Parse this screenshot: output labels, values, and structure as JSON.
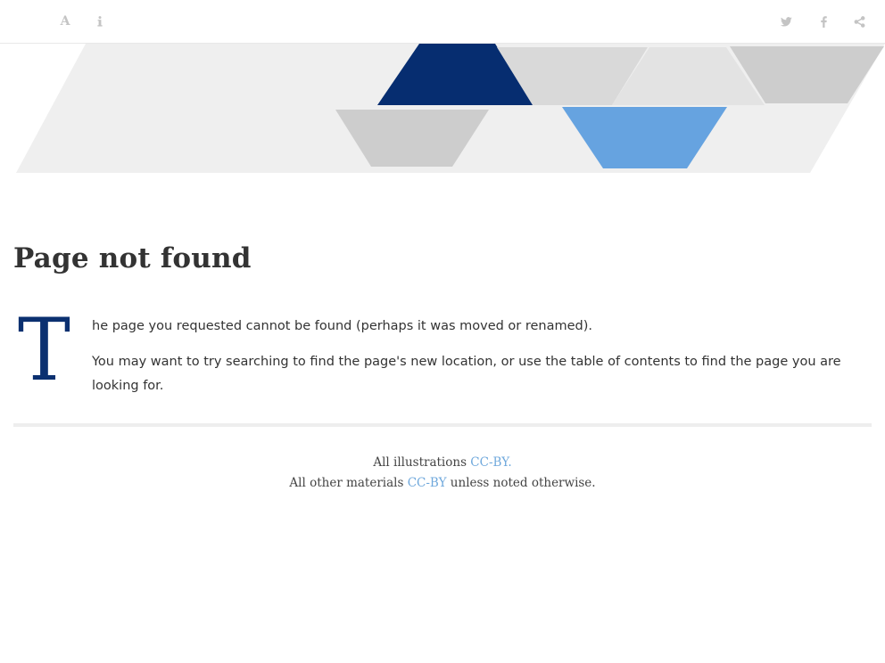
{
  "toolbar": {
    "font_icon": "font-size-icon",
    "info_icon": "info-icon",
    "twitter_icon": "twitter-icon",
    "facebook_icon": "facebook-icon",
    "share_icon": "share-icon",
    "font_glyph": "A"
  },
  "page": {
    "title": "Page not found",
    "dropcap": "T",
    "paragraph_1": "he page you requested cannot be found (perhaps it was moved or renamed).",
    "paragraph_2": "You may want to try searching to find the page's new location, or use the table of contents to find the page you are looking for."
  },
  "footer": {
    "line1_prefix": "All illustrations ",
    "line1_link": "CC-BY.",
    "line2_prefix": "All other materials ",
    "line2_link": "CC-BY",
    "line2_suffix": " unless noted otherwise."
  },
  "colors": {
    "dark_blue": "#062d70",
    "light_blue": "#66a3e0",
    "gray": "#cdcdcd",
    "pale_gray": "#ececec",
    "link": "#6fa8dc"
  }
}
